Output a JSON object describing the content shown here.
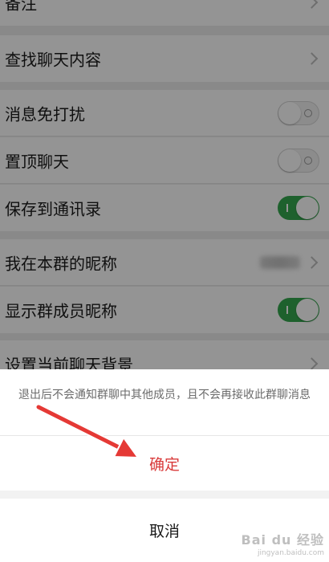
{
  "settings": {
    "remark_label": "备注",
    "search_chat_label": "查找聊天内容",
    "mute_label": "消息免打扰",
    "mute_on": false,
    "pin_label": "置顶聊天",
    "pin_on": false,
    "save_contacts_label": "保存到通讯录",
    "save_contacts_on": true,
    "my_nickname_label": "我在本群的昵称",
    "show_nicknames_label": "显示群成员昵称",
    "show_nicknames_on": true,
    "background_label": "设置当前聊天背景"
  },
  "dialog": {
    "message": "退出后不会通知群聊中其他成员，且不会再接收此群聊消息",
    "confirm_label": "确定",
    "cancel_label": "取消"
  },
  "colors": {
    "toggle_on": "#35a84f",
    "confirm_text": "#d93a3a",
    "arrow": "#e53935"
  },
  "watermark": {
    "main": "Bai du 经验",
    "sub": "jingyan.baidu.com"
  }
}
